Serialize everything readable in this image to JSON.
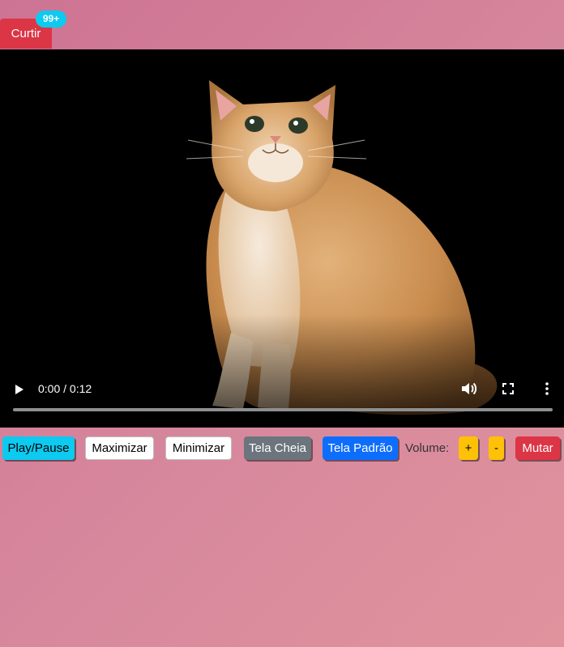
{
  "header": {
    "like_label": "Curtir",
    "like_count": "99+"
  },
  "video": {
    "time": "0:00 / 0:12",
    "progress": 0,
    "icons": {
      "play": "play-icon",
      "volume": "volume-icon",
      "fullscreen": "fullscreen-icon",
      "more": "more-vert-icon"
    }
  },
  "controls": {
    "play_pause": "Play/Pause",
    "maximize": "Maximizar",
    "minimize": "Minimizar",
    "fullscreen": "Tela Cheia",
    "default_screen": "Tela Padrão",
    "volume_label": "Volume:",
    "volume_up": "+",
    "volume_down": "-",
    "mute": "Mutar"
  },
  "colors": {
    "like": "#dc3545",
    "badge": "#0dcaf0",
    "cyan": "#0dcaf0",
    "gray": "#6c757d",
    "blue": "#0d6efd",
    "yellow": "#ffc107",
    "red": "#dc3545"
  }
}
